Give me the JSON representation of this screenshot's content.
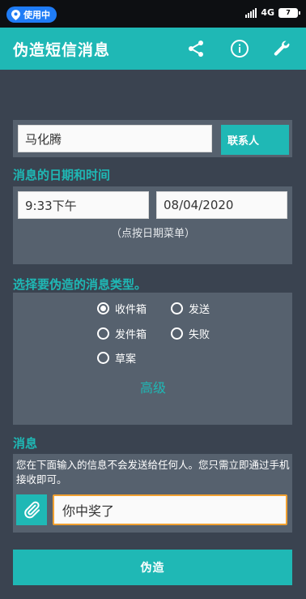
{
  "status_bar": {
    "location_label": "使用中",
    "network": "4G",
    "battery": "7"
  },
  "app_bar": {
    "title": "伪造短信消息",
    "icons": [
      "share-icon",
      "info-icon",
      "wrench-icon"
    ]
  },
  "contact": {
    "name_value": "马化腾",
    "contact_button": "联系人"
  },
  "datetime": {
    "section_title": "消息的日期和时间",
    "time_value": "9:33下午",
    "date_value": "08/04/2020",
    "hint": "（点按日期菜单）"
  },
  "message_type": {
    "section_title": "选择要伪造的消息类型。",
    "options": [
      {
        "label": "收件箱",
        "checked": true
      },
      {
        "label": "发送",
        "checked": false
      },
      {
        "label": "发件箱",
        "checked": false
      },
      {
        "label": "失败",
        "checked": false
      },
      {
        "label": "草案",
        "checked": false
      }
    ],
    "advanced_label": "高级"
  },
  "message": {
    "section_title": "消息",
    "notice": "您在下面输入的信息不会发送给任何人。您只需立即通过手机接收即可。",
    "content_value": "你中奖了"
  },
  "actions": {
    "fake_button": "伪造"
  },
  "colors": {
    "accent": "#1fb8b5",
    "background": "#3a4350",
    "panel": "#56616e",
    "input_focus_border": "#f0a030"
  }
}
